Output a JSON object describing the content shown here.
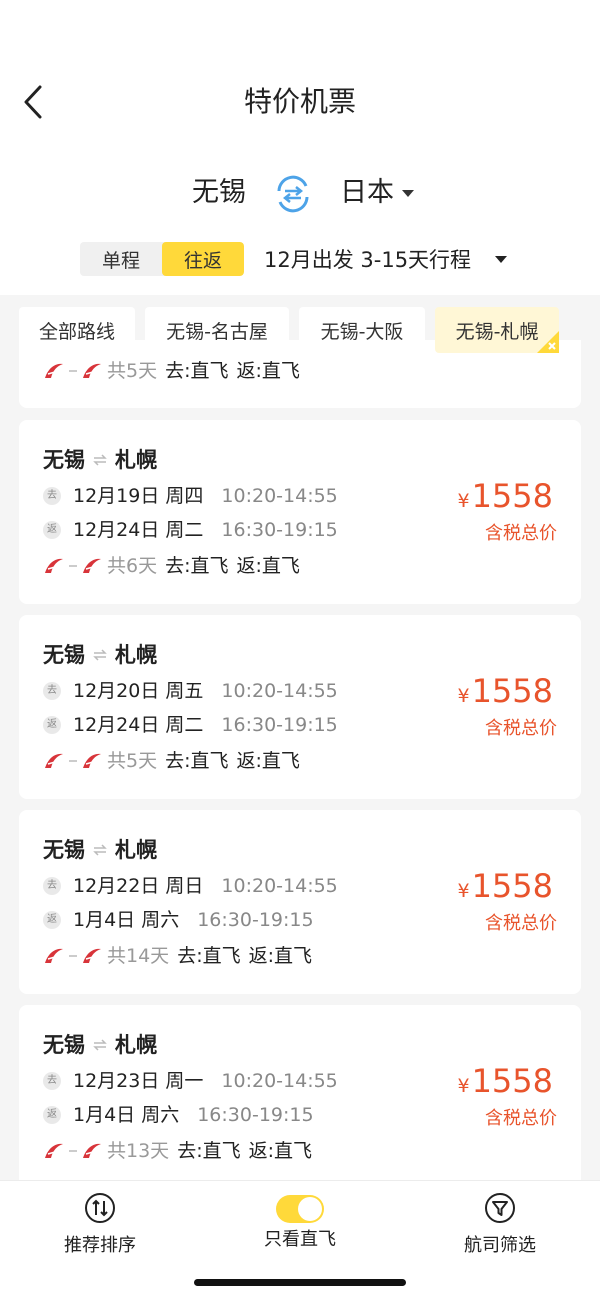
{
  "header": {
    "title": "特价机票",
    "origin": "无锡",
    "destination": "日本",
    "trip_types": [
      "单程",
      "往返"
    ],
    "active_trip_type": "往返",
    "date_filter": "12月出发 3-15天行程"
  },
  "route_chips": [
    "全部路线",
    "无锡-名古屋",
    "无锡-大阪",
    "无锡-札幌"
  ],
  "active_route_chip": "无锡-札幌",
  "partial_card": {
    "days": "共5天",
    "outbound": "去:直飞",
    "return": "返:直飞"
  },
  "cards": [
    {
      "origin": "无锡",
      "destination": "札幌",
      "out_badge": "去",
      "out_date": "12月19日 周四",
      "out_time": "10:20-14:55",
      "ret_badge": "返",
      "ret_date": "12月24日 周二",
      "ret_time": "16:30-19:15",
      "days": "共6天",
      "outbound": "去:直飞",
      "return": "返:直飞",
      "price_symbol": "¥",
      "price": "1558",
      "price_note": "含税总价"
    },
    {
      "origin": "无锡",
      "destination": "札幌",
      "out_badge": "去",
      "out_date": "12月20日 周五",
      "out_time": "10:20-14:55",
      "ret_badge": "返",
      "ret_date": "12月24日 周二",
      "ret_time": "16:30-19:15",
      "days": "共5天",
      "outbound": "去:直飞",
      "return": "返:直飞",
      "price_symbol": "¥",
      "price": "1558",
      "price_note": "含税总价"
    },
    {
      "origin": "无锡",
      "destination": "札幌",
      "out_badge": "去",
      "out_date": "12月22日 周日",
      "out_time": "10:20-14:55",
      "ret_badge": "返",
      "ret_date": "1月4日 周六",
      "ret_time": "16:30-19:15",
      "days": "共14天",
      "outbound": "去:直飞",
      "return": "返:直飞",
      "price_symbol": "¥",
      "price": "1558",
      "price_note": "含税总价"
    },
    {
      "origin": "无锡",
      "destination": "札幌",
      "out_badge": "去",
      "out_date": "12月23日 周一",
      "out_time": "10:20-14:55",
      "ret_badge": "返",
      "ret_date": "1月4日 周六",
      "ret_time": "16:30-19:15",
      "days": "共13天",
      "outbound": "去:直飞",
      "return": "返:直飞",
      "price_symbol": "¥",
      "price": "1558",
      "price_note": "含税总价"
    }
  ],
  "bottom_bar": {
    "sort_label": "推荐排序",
    "direct_label": "只看直飞",
    "direct_only": true,
    "airline_label": "航司筛选"
  },
  "colors": {
    "accent_yellow": "#ffd93a",
    "price_red": "#e8542c",
    "airline_red": "#d8343a"
  },
  "icons": {
    "back": "back-arrow-icon",
    "swap": "swap-arrows-icon",
    "dropdown": "caret-down-icon",
    "chip_close": "close-corner-icon",
    "airline": "airline-logo-icon",
    "sort": "sort-arrows-icon",
    "filter": "funnel-icon"
  }
}
